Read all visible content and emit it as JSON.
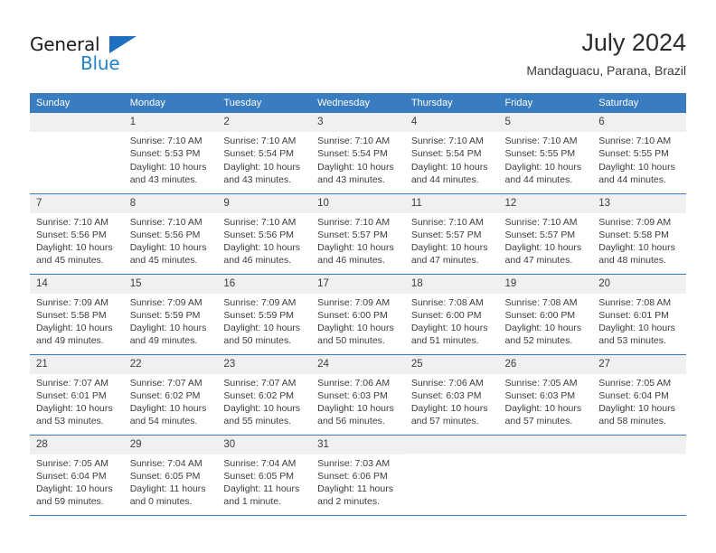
{
  "brand": {
    "name_part1": "General",
    "name_part2": "Blue",
    "triangle_color": "#1f6fbf",
    "blue_color": "#2383c7"
  },
  "header": {
    "title": "July 2024",
    "subtitle": "Mandaguacu, Parana, Brazil"
  },
  "theme": {
    "header_bg": "#3a7cc0",
    "header_text": "#ffffff",
    "band_bg": "#f0f0f0",
    "body_text": "#3c3c3c",
    "grid_line": "#3a7cc0"
  },
  "weekday_headers": [
    "Sunday",
    "Monday",
    "Tuesday",
    "Wednesday",
    "Thursday",
    "Friday",
    "Saturday"
  ],
  "weeks": [
    [
      {
        "day": "",
        "sunrise": "",
        "sunset": "",
        "daylight_line1": "",
        "daylight_line2": ""
      },
      {
        "day": "1",
        "sunrise": "Sunrise: 7:10 AM",
        "sunset": "Sunset: 5:53 PM",
        "daylight_line1": "Daylight: 10 hours",
        "daylight_line2": "and 43 minutes."
      },
      {
        "day": "2",
        "sunrise": "Sunrise: 7:10 AM",
        "sunset": "Sunset: 5:54 PM",
        "daylight_line1": "Daylight: 10 hours",
        "daylight_line2": "and 43 minutes."
      },
      {
        "day": "3",
        "sunrise": "Sunrise: 7:10 AM",
        "sunset": "Sunset: 5:54 PM",
        "daylight_line1": "Daylight: 10 hours",
        "daylight_line2": "and 43 minutes."
      },
      {
        "day": "4",
        "sunrise": "Sunrise: 7:10 AM",
        "sunset": "Sunset: 5:54 PM",
        "daylight_line1": "Daylight: 10 hours",
        "daylight_line2": "and 44 minutes."
      },
      {
        "day": "5",
        "sunrise": "Sunrise: 7:10 AM",
        "sunset": "Sunset: 5:55 PM",
        "daylight_line1": "Daylight: 10 hours",
        "daylight_line2": "and 44 minutes."
      },
      {
        "day": "6",
        "sunrise": "Sunrise: 7:10 AM",
        "sunset": "Sunset: 5:55 PM",
        "daylight_line1": "Daylight: 10 hours",
        "daylight_line2": "and 44 minutes."
      }
    ],
    [
      {
        "day": "7",
        "sunrise": "Sunrise: 7:10 AM",
        "sunset": "Sunset: 5:56 PM",
        "daylight_line1": "Daylight: 10 hours",
        "daylight_line2": "and 45 minutes."
      },
      {
        "day": "8",
        "sunrise": "Sunrise: 7:10 AM",
        "sunset": "Sunset: 5:56 PM",
        "daylight_line1": "Daylight: 10 hours",
        "daylight_line2": "and 45 minutes."
      },
      {
        "day": "9",
        "sunrise": "Sunrise: 7:10 AM",
        "sunset": "Sunset: 5:56 PM",
        "daylight_line1": "Daylight: 10 hours",
        "daylight_line2": "and 46 minutes."
      },
      {
        "day": "10",
        "sunrise": "Sunrise: 7:10 AM",
        "sunset": "Sunset: 5:57 PM",
        "daylight_line1": "Daylight: 10 hours",
        "daylight_line2": "and 46 minutes."
      },
      {
        "day": "11",
        "sunrise": "Sunrise: 7:10 AM",
        "sunset": "Sunset: 5:57 PM",
        "daylight_line1": "Daylight: 10 hours",
        "daylight_line2": "and 47 minutes."
      },
      {
        "day": "12",
        "sunrise": "Sunrise: 7:10 AM",
        "sunset": "Sunset: 5:57 PM",
        "daylight_line1": "Daylight: 10 hours",
        "daylight_line2": "and 47 minutes."
      },
      {
        "day": "13",
        "sunrise": "Sunrise: 7:09 AM",
        "sunset": "Sunset: 5:58 PM",
        "daylight_line1": "Daylight: 10 hours",
        "daylight_line2": "and 48 minutes."
      }
    ],
    [
      {
        "day": "14",
        "sunrise": "Sunrise: 7:09 AM",
        "sunset": "Sunset: 5:58 PM",
        "daylight_line1": "Daylight: 10 hours",
        "daylight_line2": "and 49 minutes."
      },
      {
        "day": "15",
        "sunrise": "Sunrise: 7:09 AM",
        "sunset": "Sunset: 5:59 PM",
        "daylight_line1": "Daylight: 10 hours",
        "daylight_line2": "and 49 minutes."
      },
      {
        "day": "16",
        "sunrise": "Sunrise: 7:09 AM",
        "sunset": "Sunset: 5:59 PM",
        "daylight_line1": "Daylight: 10 hours",
        "daylight_line2": "and 50 minutes."
      },
      {
        "day": "17",
        "sunrise": "Sunrise: 7:09 AM",
        "sunset": "Sunset: 6:00 PM",
        "daylight_line1": "Daylight: 10 hours",
        "daylight_line2": "and 50 minutes."
      },
      {
        "day": "18",
        "sunrise": "Sunrise: 7:08 AM",
        "sunset": "Sunset: 6:00 PM",
        "daylight_line1": "Daylight: 10 hours",
        "daylight_line2": "and 51 minutes."
      },
      {
        "day": "19",
        "sunrise": "Sunrise: 7:08 AM",
        "sunset": "Sunset: 6:00 PM",
        "daylight_line1": "Daylight: 10 hours",
        "daylight_line2": "and 52 minutes."
      },
      {
        "day": "20",
        "sunrise": "Sunrise: 7:08 AM",
        "sunset": "Sunset: 6:01 PM",
        "daylight_line1": "Daylight: 10 hours",
        "daylight_line2": "and 53 minutes."
      }
    ],
    [
      {
        "day": "21",
        "sunrise": "Sunrise: 7:07 AM",
        "sunset": "Sunset: 6:01 PM",
        "daylight_line1": "Daylight: 10 hours",
        "daylight_line2": "and 53 minutes."
      },
      {
        "day": "22",
        "sunrise": "Sunrise: 7:07 AM",
        "sunset": "Sunset: 6:02 PM",
        "daylight_line1": "Daylight: 10 hours",
        "daylight_line2": "and 54 minutes."
      },
      {
        "day": "23",
        "sunrise": "Sunrise: 7:07 AM",
        "sunset": "Sunset: 6:02 PM",
        "daylight_line1": "Daylight: 10 hours",
        "daylight_line2": "and 55 minutes."
      },
      {
        "day": "24",
        "sunrise": "Sunrise: 7:06 AM",
        "sunset": "Sunset: 6:03 PM",
        "daylight_line1": "Daylight: 10 hours",
        "daylight_line2": "and 56 minutes."
      },
      {
        "day": "25",
        "sunrise": "Sunrise: 7:06 AM",
        "sunset": "Sunset: 6:03 PM",
        "daylight_line1": "Daylight: 10 hours",
        "daylight_line2": "and 57 minutes."
      },
      {
        "day": "26",
        "sunrise": "Sunrise: 7:05 AM",
        "sunset": "Sunset: 6:03 PM",
        "daylight_line1": "Daylight: 10 hours",
        "daylight_line2": "and 57 minutes."
      },
      {
        "day": "27",
        "sunrise": "Sunrise: 7:05 AM",
        "sunset": "Sunset: 6:04 PM",
        "daylight_line1": "Daylight: 10 hours",
        "daylight_line2": "and 58 minutes."
      }
    ],
    [
      {
        "day": "28",
        "sunrise": "Sunrise: 7:05 AM",
        "sunset": "Sunset: 6:04 PM",
        "daylight_line1": "Daylight: 10 hours",
        "daylight_line2": "and 59 minutes."
      },
      {
        "day": "29",
        "sunrise": "Sunrise: 7:04 AM",
        "sunset": "Sunset: 6:05 PM",
        "daylight_line1": "Daylight: 11 hours",
        "daylight_line2": "and 0 minutes."
      },
      {
        "day": "30",
        "sunrise": "Sunrise: 7:04 AM",
        "sunset": "Sunset: 6:05 PM",
        "daylight_line1": "Daylight: 11 hours",
        "daylight_line2": "and 1 minute."
      },
      {
        "day": "31",
        "sunrise": "Sunrise: 7:03 AM",
        "sunset": "Sunset: 6:06 PM",
        "daylight_line1": "Daylight: 11 hours",
        "daylight_line2": "and 2 minutes."
      },
      {
        "day": "",
        "sunrise": "",
        "sunset": "",
        "daylight_line1": "",
        "daylight_line2": ""
      },
      {
        "day": "",
        "sunrise": "",
        "sunset": "",
        "daylight_line1": "",
        "daylight_line2": ""
      },
      {
        "day": "",
        "sunrise": "",
        "sunset": "",
        "daylight_line1": "",
        "daylight_line2": ""
      }
    ]
  ]
}
